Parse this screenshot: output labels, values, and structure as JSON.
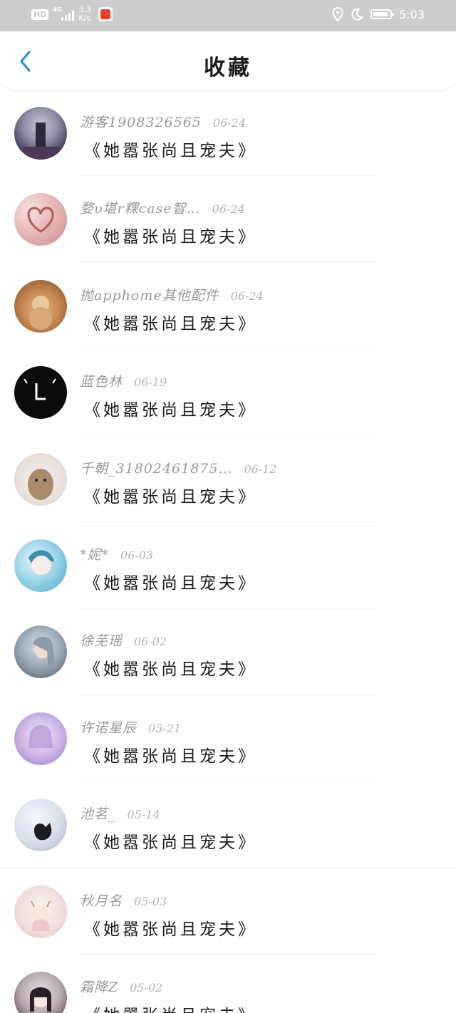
{
  "status_bar": {
    "hd": "HD",
    "network": "4G",
    "speed_top": "3.3",
    "speed_bottom": "K/s",
    "time": "5:03",
    "battery_level": 0.75,
    "icons": [
      "app-icon",
      "location-icon",
      "moon-icon",
      "battery-icon"
    ]
  },
  "header": {
    "title": "收藏",
    "back_icon": "chevron-left-icon",
    "back_color": "#2b8ee5"
  },
  "items": [
    {
      "user": "游客1908326565",
      "date": "06-24",
      "title": "《她嚣张尚且宠夫》"
    },
    {
      "user": "婺υ堪r粿case智…",
      "date": "06-24",
      "title": "《她嚣张尚且宠夫》"
    },
    {
      "user": "抛apphome其他配件",
      "date": "06-24",
      "title": "《她嚣张尚且宠夫》"
    },
    {
      "user": "蓝色林",
      "date": "06-19",
      "title": "《她嚣张尚且宠夫》"
    },
    {
      "user": "千朝_31802461875…",
      "date": "06-12",
      "title": "《她嚣张尚且宠夫》"
    },
    {
      "user": "*妮*",
      "date": "06-03",
      "title": "《她嚣张尚且宠夫》"
    },
    {
      "user": "徐芜瑶",
      "date": "06-02",
      "title": "《她嚣张尚且宠夫》"
    },
    {
      "user": "许诺星辰",
      "date": "05-21",
      "title": "《她嚣张尚且宠夫》"
    },
    {
      "user": "池茗_",
      "date": "05-14",
      "title": "《她嚣张尚且宠夫》"
    },
    {
      "user": "秋月名",
      "date": "05-03",
      "title": "《她嚣张尚且宠夫》"
    },
    {
      "user": "霜降Z",
      "date": "05-02",
      "title": "《她嚣张尚且宠夫》"
    }
  ],
  "colors": {
    "status_bar_bg": "#cdcdcd",
    "accent": "#2b8ee5",
    "username": "#9a9a9a",
    "date": "#b4b4b4",
    "title_text": "#1a1a1a"
  }
}
